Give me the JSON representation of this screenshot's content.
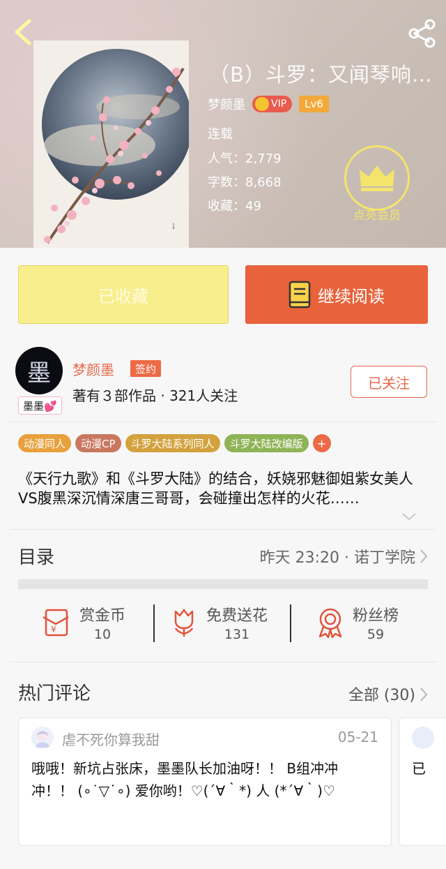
{
  "header": {
    "title": "（B）斗罗：又闻琴响…",
    "author": "梦颜墨",
    "vip_label": "VIP",
    "level": "Lv6",
    "status": "连载",
    "popularity_label": "人气：",
    "popularity": "2,779",
    "words_label": "字数：",
    "words": "8,668",
    "favorites_label": "收藏：",
    "favorites": "49",
    "member_label": "点亮会员"
  },
  "actions": {
    "collected_label": "已收藏",
    "read_label": "继续阅读"
  },
  "author": {
    "avatar_char": "墨",
    "tag": "墨墨💕",
    "name": "梦颜墨",
    "signed_label": "签约",
    "stats": "著有３部作品 · 321人关注",
    "follow_label": "已关注"
  },
  "tags": [
    {
      "label": "动漫同人",
      "color": "#e8a13c"
    },
    {
      "label": "动漫CP",
      "color": "#c9775f"
    },
    {
      "label": "斗罗大陆系列同人",
      "color": "#d3a23e"
    },
    {
      "label": "斗罗大陆改编版",
      "color": "#8fb357"
    }
  ],
  "tag_more": "+",
  "description": "《天行九歌》和《斗罗大陆》的结合，妖娆邪魅御姐紫女美人VS腹黑深沉情深唐三哥哥，会碰撞出怎样的火花……",
  "toc": {
    "label": "目录",
    "info": "昨天 23:20 · 诺丁学院"
  },
  "rewards": [
    {
      "label": "赏金币",
      "count": "10"
    },
    {
      "label": "免费送花",
      "count": "131"
    },
    {
      "label": "粉丝榜",
      "count": "59"
    }
  ],
  "comments": {
    "label": "热门评论",
    "all_label": "全部 (30)",
    "items": [
      {
        "user": "虐不死你算我甜",
        "date": "05-21",
        "text": "哦哦！新坑占张床，墨墨队长加油呀！！ B组冲冲冲！！ (∘˙▽˙∘) 爱你哟！♡(´∀｀*) 人 (*´∀｀)♡"
      },
      {
        "text": "已"
      }
    ]
  },
  "colors": {
    "accent": "#e8623b",
    "collected_bg": "#f8ee8c",
    "member_yellow": "#f4e46c"
  }
}
